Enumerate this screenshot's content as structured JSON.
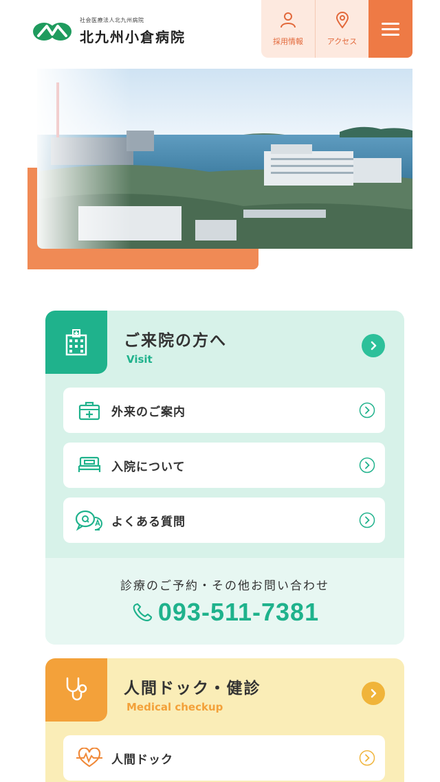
{
  "header": {
    "logo_sub": "社会医療法人北九州病院",
    "logo_name": "北九州小倉病院",
    "nav": [
      {
        "label": "採用情報",
        "icon": "person-icon"
      },
      {
        "label": "アクセス",
        "icon": "map-pin-icon"
      }
    ],
    "menu_icon": "hamburger-menu-icon"
  },
  "colors": {
    "accent_orange": "#ee7a45",
    "visit_green": "#1fb28c",
    "visit_bg": "#d7f2e9",
    "dock_orange": "#f3a13a",
    "dock_bg": "#faedb7"
  },
  "visit": {
    "title": "ご来院の方へ",
    "subtitle": "Visit",
    "icon": "hospital-building-icon",
    "links": [
      {
        "label": "外来のご案内",
        "icon": "medical-box-icon"
      },
      {
        "label": "入院について",
        "icon": "bed-icon"
      },
      {
        "label": "よくある質問",
        "icon": "qa-bubble-icon"
      }
    ],
    "contact_label": "診療のご予約・その他お問い合わせ",
    "phone": "093-511-7381"
  },
  "dock": {
    "title": "人間ドック・健診",
    "subtitle": "Medical checkup",
    "icon": "stethoscope-icon",
    "links": [
      {
        "label": "人間ドック",
        "icon": "heart-pulse-icon"
      }
    ]
  }
}
